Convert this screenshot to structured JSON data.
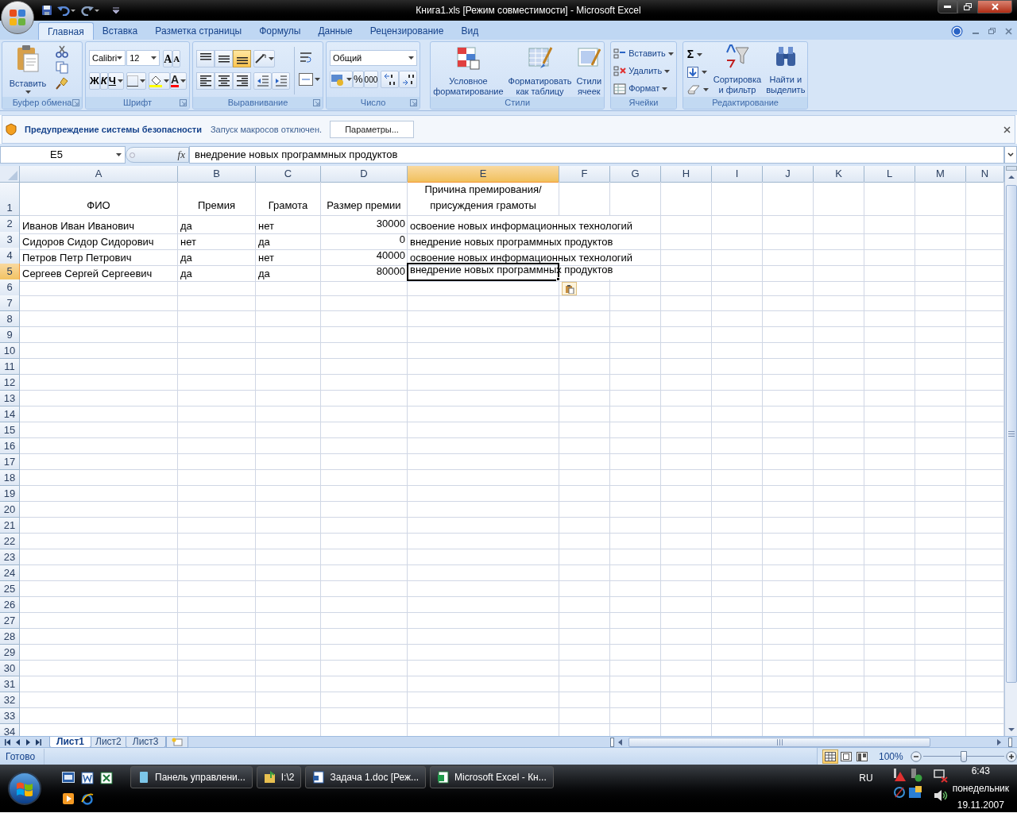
{
  "window": {
    "title": "Книга1.xls  [Режим совместимости] - Microsoft Excel"
  },
  "ribbon_tabs": [
    {
      "label": "Главная",
      "selected": true
    },
    {
      "label": "Вставка",
      "selected": false
    },
    {
      "label": "Разметка страницы",
      "selected": false
    },
    {
      "label": "Формулы",
      "selected": false
    },
    {
      "label": "Данные",
      "selected": false
    },
    {
      "label": "Рецензирование",
      "selected": false
    },
    {
      "label": "Вид",
      "selected": false
    }
  ],
  "clipboard": {
    "paste": "Вставить",
    "label": "Буфер обмена"
  },
  "font": {
    "name": "Calibri",
    "size": "12",
    "grow": "A",
    "shrink": "A",
    "bold": "Ж",
    "italic": "К",
    "underline": "Ч",
    "font_color": "А",
    "label": "Шрифт"
  },
  "alignment": {
    "vertical": [
      {
        "kind": "top",
        "selected": false
      },
      {
        "kind": "middle",
        "selected": false
      },
      {
        "kind": "bottom",
        "selected": true
      }
    ],
    "horizontal": [
      {
        "kind": "left",
        "selected": false
      },
      {
        "kind": "center",
        "selected": false
      },
      {
        "kind": "right",
        "selected": false
      }
    ],
    "label": "Выравнивание"
  },
  "number": {
    "format": "Общий",
    "percent": "%",
    "thousands": "000",
    "label": "Число"
  },
  "styles": {
    "buttons": [
      {
        "lines": [
          "Условное",
          "форматирование"
        ]
      },
      {
        "lines": [
          "Форматировать",
          "как таблицу"
        ]
      },
      {
        "lines": [
          "Стили",
          "ячеек"
        ]
      }
    ],
    "label": "Стили"
  },
  "cells": {
    "buttons": [
      "Вставить",
      "Удалить",
      "Формат"
    ],
    "label": "Ячейки"
  },
  "editing": {
    "sum": "Σ",
    "buttons": [
      {
        "lines": [
          "Сортировка",
          "и фильтр"
        ]
      },
      {
        "lines": [
          "Найти и",
          "выделить"
        ]
      }
    ],
    "label": "Редактирование"
  },
  "security_bar": {
    "title": "Предупреждение системы безопасности",
    "message": "Запуск макросов отключен.",
    "button": "Параметры..."
  },
  "formula_bar": {
    "name_box": "E5",
    "fx": "fx",
    "value": "внедрение новых программных продуктов"
  },
  "sheet": {
    "columns": [
      {
        "label": "A",
        "kind": "text",
        "selected": false
      },
      {
        "label": "B",
        "kind": "text",
        "selected": false
      },
      {
        "label": "C",
        "kind": "text",
        "selected": false
      },
      {
        "label": "D",
        "kind": "number",
        "selected": false
      },
      {
        "label": "E",
        "kind": "text",
        "selected": true
      },
      {
        "label": "F",
        "kind": "text",
        "selected": false
      },
      {
        "label": "G",
        "kind": "text",
        "selected": false
      },
      {
        "label": "H",
        "kind": "text",
        "selected": false
      },
      {
        "label": "I",
        "kind": "text",
        "selected": false
      },
      {
        "label": "J",
        "kind": "text",
        "selected": false
      },
      {
        "label": "K",
        "kind": "text",
        "selected": false
      },
      {
        "label": "L",
        "kind": "text",
        "selected": false
      },
      {
        "label": "M",
        "kind": "text",
        "selected": false
      },
      {
        "label": "N",
        "kind": "text",
        "selected": false
      }
    ],
    "rows": [
      {
        "number": "1",
        "kind": "header",
        "selected": false,
        "cells": [
          "ФИО",
          "Премия",
          "Грамота",
          "Размер премии",
          "Причина премирования/ присуждения грамоты"
        ]
      },
      {
        "number": "2",
        "kind": "data",
        "selected": false,
        "cells": [
          "Иванов Иван Иванович",
          "да",
          "нет",
          "30000",
          "освоение новых информационных технологий"
        ]
      },
      {
        "number": "3",
        "kind": "data",
        "selected": false,
        "cells": [
          "Сидоров Сидор Сидорович",
          "нет",
          "да",
          "0",
          "внедрение новых программных продуктов"
        ]
      },
      {
        "number": "4",
        "kind": "data",
        "selected": false,
        "cells": [
          "Петров Петр Петрович",
          "да",
          "нет",
          "40000",
          "освоение новых информационных технологий"
        ]
      },
      {
        "number": "5",
        "kind": "data",
        "selected": true,
        "cells": [
          "Сергеев Сергей Сергеевич",
          "да",
          "да",
          "80000",
          "внедрение новых программных продуктов"
        ]
      },
      {
        "number": "6",
        "kind": "data",
        "selected": false
      },
      {
        "number": "7",
        "kind": "data",
        "selected": false
      },
      {
        "number": "8",
        "kind": "data",
        "selected": false
      },
      {
        "number": "9",
        "kind": "data",
        "selected": false
      },
      {
        "number": "10",
        "kind": "data",
        "selected": false
      },
      {
        "number": "11",
        "kind": "data",
        "selected": false
      },
      {
        "number": "12",
        "kind": "data",
        "selected": false
      },
      {
        "number": "13",
        "kind": "data",
        "selected": false
      },
      {
        "number": "14",
        "kind": "data",
        "selected": false
      },
      {
        "number": "15",
        "kind": "data",
        "selected": false
      },
      {
        "number": "16",
        "kind": "data",
        "selected": false
      },
      {
        "number": "17",
        "kind": "data",
        "selected": false
      },
      {
        "number": "18",
        "kind": "data",
        "selected": false
      },
      {
        "number": "19",
        "kind": "data",
        "selected": false
      },
      {
        "number": "20",
        "kind": "data",
        "selected": false
      },
      {
        "number": "21",
        "kind": "data",
        "selected": false
      },
      {
        "number": "22",
        "kind": "data",
        "selected": false
      },
      {
        "number": "23",
        "kind": "data",
        "selected": false
      },
      {
        "number": "24",
        "kind": "data",
        "selected": false
      },
      {
        "number": "25",
        "kind": "data",
        "selected": false
      },
      {
        "number": "26",
        "kind": "data",
        "selected": false
      },
      {
        "number": "27",
        "kind": "data",
        "selected": false
      },
      {
        "number": "28",
        "kind": "data",
        "selected": false
      },
      {
        "number": "29",
        "kind": "data",
        "selected": false
      },
      {
        "number": "30",
        "kind": "data",
        "selected": false
      },
      {
        "number": "31",
        "kind": "data",
        "selected": false
      },
      {
        "number": "32",
        "kind": "data",
        "selected": false
      },
      {
        "number": "33",
        "kind": "data",
        "selected": false
      },
      {
        "number": "34",
        "kind": "data",
        "selected": false
      }
    ]
  },
  "sheet_tabs": [
    {
      "label": "Лист1",
      "selected": true
    },
    {
      "label": "Лист2",
      "selected": false
    },
    {
      "label": "Лист3",
      "selected": false
    }
  ],
  "status_bar": {
    "status": "Готово",
    "view_modes": [
      {
        "kind": "normal",
        "selected": true
      },
      {
        "kind": "page_layout",
        "selected": false
      },
      {
        "kind": "page_break",
        "selected": false
      }
    ],
    "zoom": "100%",
    "zoom_slider": {
      "level": 0.5
    }
  },
  "taskbar": {
    "buttons": [
      {
        "kind": "control_panel",
        "label": "Панель управлени..."
      },
      {
        "kind": "folder",
        "label": "I:\\2"
      },
      {
        "kind": "word",
        "label": "Задача  1.doc [Реж..."
      },
      {
        "kind": "excel",
        "label": "Microsoft Excel - Кн..."
      }
    ],
    "language": "RU",
    "time": "6:43",
    "day": "понедельник",
    "date": "19.11.2007"
  }
}
